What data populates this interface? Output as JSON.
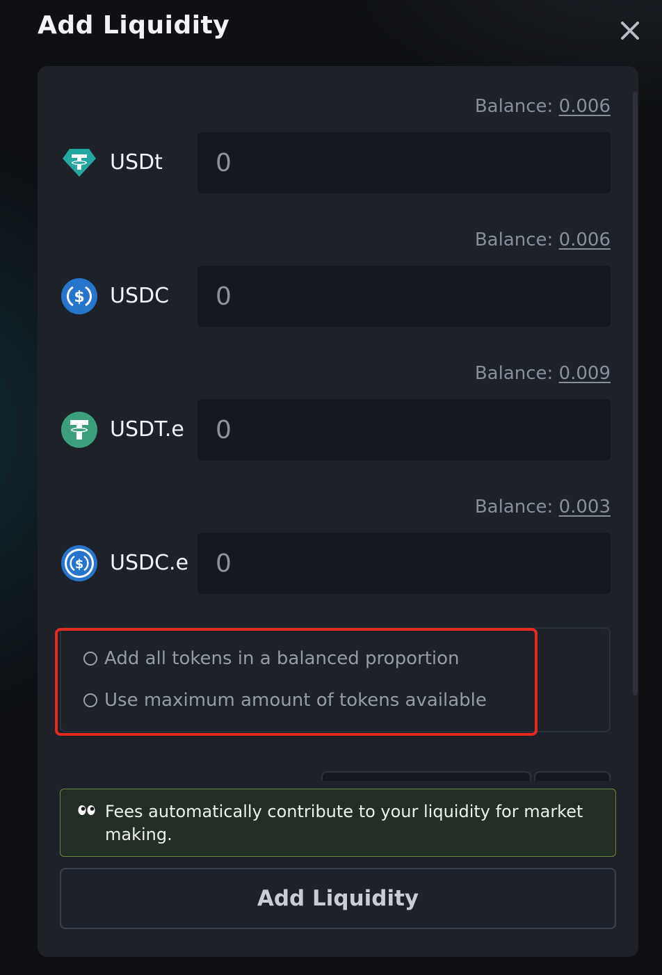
{
  "modal": {
    "title": "Add Liquidity",
    "close_icon": "close-icon"
  },
  "tokens": [
    {
      "symbol": "USDt",
      "balance_label": "Balance:",
      "balance": "0.006",
      "value": "0",
      "icon": "tether-gem-icon",
      "color": "#26a6a0"
    },
    {
      "symbol": "USDC",
      "balance_label": "Balance:",
      "balance": "0.006",
      "value": "0",
      "icon": "usdc-icon",
      "color": "#2775ca"
    },
    {
      "symbol": "USDT.e",
      "balance_label": "Balance:",
      "balance": "0.009",
      "value": "0",
      "icon": "tether-icon",
      "color": "#3d9f7c"
    },
    {
      "symbol": "USDC.e",
      "balance_label": "Balance:",
      "balance": "0.003",
      "value": "0",
      "icon": "usdc-icon",
      "color": "#2775ca"
    }
  ],
  "options": [
    {
      "label": "Add all tokens in a balanced proportion",
      "selected": false
    },
    {
      "label": "Use maximum amount of tokens available",
      "selected": false
    }
  ],
  "notice": {
    "icon": "eyes-icon",
    "text": "Fees automatically contribute to your liquidity for market making."
  },
  "submit": {
    "label": "Add Liquidity"
  },
  "colors": {
    "highlight": "#e4291f",
    "notice_border": "#6b8a3c"
  }
}
